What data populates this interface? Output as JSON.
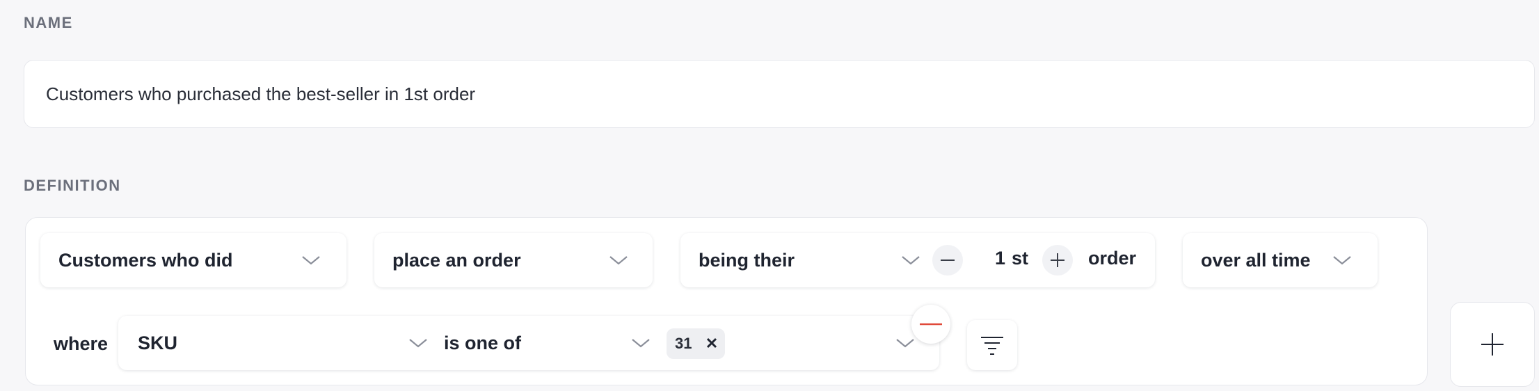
{
  "name_section": {
    "label": "NAME",
    "value": "Customers who purchased the best-seller in 1st order"
  },
  "definition_section": {
    "label": "DEFINITION",
    "row1": {
      "subject_select": "Customers who did",
      "event_select": "place an order",
      "ordinal_select": "being their",
      "ordinal_number": "1",
      "ordinal_suffix": "st",
      "order_word": "order",
      "time_select": "over all time"
    },
    "row2": {
      "where_label": "where",
      "property_select": "SKU",
      "operator_select": "is one of",
      "value_tags": [
        "31"
      ]
    }
  },
  "icons": {
    "chevron": "chevron-down-icon",
    "minus": "minus-icon",
    "plus": "plus-icon",
    "remove": "remove-condition-icon",
    "filter": "filter-icon",
    "add": "add-condition-icon",
    "tag_close": "close-icon"
  },
  "colors": {
    "background": "#f7f7f9",
    "card": "#ffffff",
    "remove_accent": "#e04a3a",
    "muted_label": "#6b6f7b"
  }
}
